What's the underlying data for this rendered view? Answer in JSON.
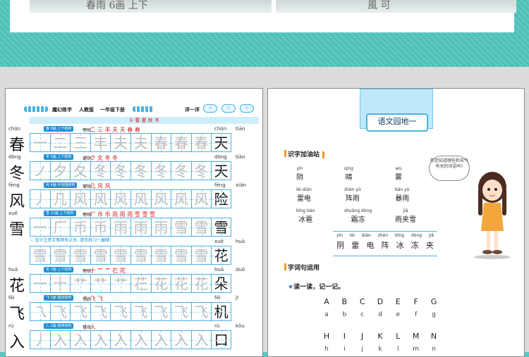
{
  "thumbnails": {
    "left_text": "春雨 6画 上下",
    "right_text": "風 可"
  },
  "left_page": {
    "header": {
      "book": "魔幻练字",
      "edition": "人教版",
      "grade": "一年级下册",
      "rating": "评一评",
      "rating_stars": [
        "☆",
        "☆",
        "☆"
      ]
    },
    "lesson_title": "① 春 夏 秋 冬",
    "tip": "☆ 宝贝注意字笔顺有点多, 请多练习一遍哦!",
    "rows": [
      {
        "left_py": "chūn",
        "right_py1": "chūn",
        "right_py2": "tiān",
        "tag": "春 9画 上下结构",
        "stroke_label": "笔顺:",
        "strokes": "一 二 三 丰 夫 夫 春 春",
        "label": "春",
        "cells": [
          "一",
          "二",
          "三",
          "丰",
          "夫",
          "夫",
          "春",
          "春",
          "春",
          "天"
        ]
      },
      {
        "left_py": "dōng",
        "right_py1": "dōng",
        "right_py2": "tiān",
        "tag": "冬 5画 上下结构",
        "stroke_label": "笔顺:",
        "strokes": "ノ ク 夂 冬 冬",
        "label": "冬",
        "cells": [
          "ノ",
          "夕",
          "夂",
          "冬",
          "冬",
          "冬",
          "冬",
          "冬",
          "冬",
          "天"
        ]
      },
      {
        "left_py": "fēng",
        "right_py1": "fēng",
        "right_py2": "xiǎn",
        "tag": "风 4画 半包围结构",
        "stroke_label": "笔顺:",
        "strokes": "ノ 几 风 风",
        "label": "风",
        "cells": [
          "丿",
          "几",
          "风",
          "风",
          "风",
          "风",
          "风",
          "风",
          "风",
          "险"
        ]
      },
      {
        "left_py": "xuě",
        "right_py1": "",
        "right_py2": "",
        "tag": "雪 11画 上下结构",
        "stroke_label": "笔顺:",
        "strokes": "一 厂 币 币 雨 雨 雨 雪 雪 雪",
        "label": "雪",
        "cells": [
          "一",
          "厂",
          "币",
          "币",
          "雨",
          "雨",
          "雨",
          "雪",
          "雪",
          "雪"
        ]
      },
      {
        "left_py": "",
        "right_py1": "xuě",
        "right_py2": "huā",
        "tag": "",
        "stroke_label": "",
        "strokes": "",
        "label": "",
        "cells": [
          "雪",
          "雪",
          "雪",
          "雪",
          "雪",
          "雪",
          "雪",
          "雪",
          "雪",
          "花"
        ]
      },
      {
        "left_py": "huā",
        "right_py1": "huā",
        "right_py2": "duǒ",
        "tag": "花 7画 上下结构",
        "stroke_label": "笔顺:",
        "strokes": "一 十 艹 艹 芢 花",
        "label": "花",
        "cells": [
          "一",
          "十",
          "艹",
          "艹",
          "艹",
          "芢",
          "花",
          "花",
          "花",
          "朵"
        ]
      },
      {
        "left_py": "fēi",
        "right_py1": "fēi",
        "right_py2": "jī",
        "tag": "飞 3画 独体结构",
        "stroke_label": "笔顺:",
        "strokes": "乁 飞 飞",
        "label": "飞",
        "cells": [
          "乁",
          "飞",
          "飞",
          "飞",
          "飞",
          "飞",
          "飞",
          "飞",
          "飞",
          "机"
        ]
      },
      {
        "left_py": "rù",
        "right_py1": "rù",
        "right_py2": "kǒu",
        "tag": "入 2画 独体结构",
        "stroke_label": "笔顺:",
        "strokes": "丿 入",
        "label": "入",
        "cells": [
          "丿",
          "入",
          "入",
          "入",
          "入",
          "入",
          "入",
          "入",
          "入",
          "口"
        ]
      }
    ]
  },
  "right_page": {
    "title": "语文园地一",
    "section1": "识字加油站",
    "bubble": "你还知道哪些和天气有关的词语吗?",
    "words": [
      {
        "py": "yīn",
        "w": "阴"
      },
      {
        "py": "qíng",
        "w": "晴"
      },
      {
        "py": "wù",
        "w": "雾"
      },
      {
        "py": "léi diàn",
        "w": "雷电"
      },
      {
        "py": "zhèn yǔ",
        "w": "阵雨"
      },
      {
        "py": "bào yǔ",
        "w": "暴雨"
      },
      {
        "py": "bīng báo",
        "w": "冰雹"
      },
      {
        "py": "shuāng dòng",
        "w": "霜冻"
      },
      {
        "py": "jiā",
        "w": "雨夹雪"
      }
    ],
    "verse_pinyin": [
      "yīn",
      "léi",
      "diàn",
      "zhèn",
      "bīng",
      "dòng",
      "jiā"
    ],
    "verse_chars": [
      "阴",
      "雷",
      "电",
      "阵",
      "冰",
      "冻",
      "夹"
    ],
    "section2": "字词句运用",
    "read_line": "读一读，记一记。",
    "upper1": [
      "A",
      "B",
      "C",
      "D",
      "E",
      "F",
      "G"
    ],
    "lower1": [
      "a",
      "b",
      "c",
      "d",
      "e",
      "f",
      "g"
    ],
    "upper2": [
      "H",
      "I",
      "J",
      "K",
      "L",
      "M",
      "N"
    ],
    "lower2": [
      "h",
      "i",
      "j",
      "k",
      "l",
      "m",
      "n"
    ]
  },
  "colors": {
    "teal": "#58c6bf",
    "grid_blue": "#49b3e2",
    "accent_orange": "#f09a2a",
    "red": "#d21e1e"
  }
}
